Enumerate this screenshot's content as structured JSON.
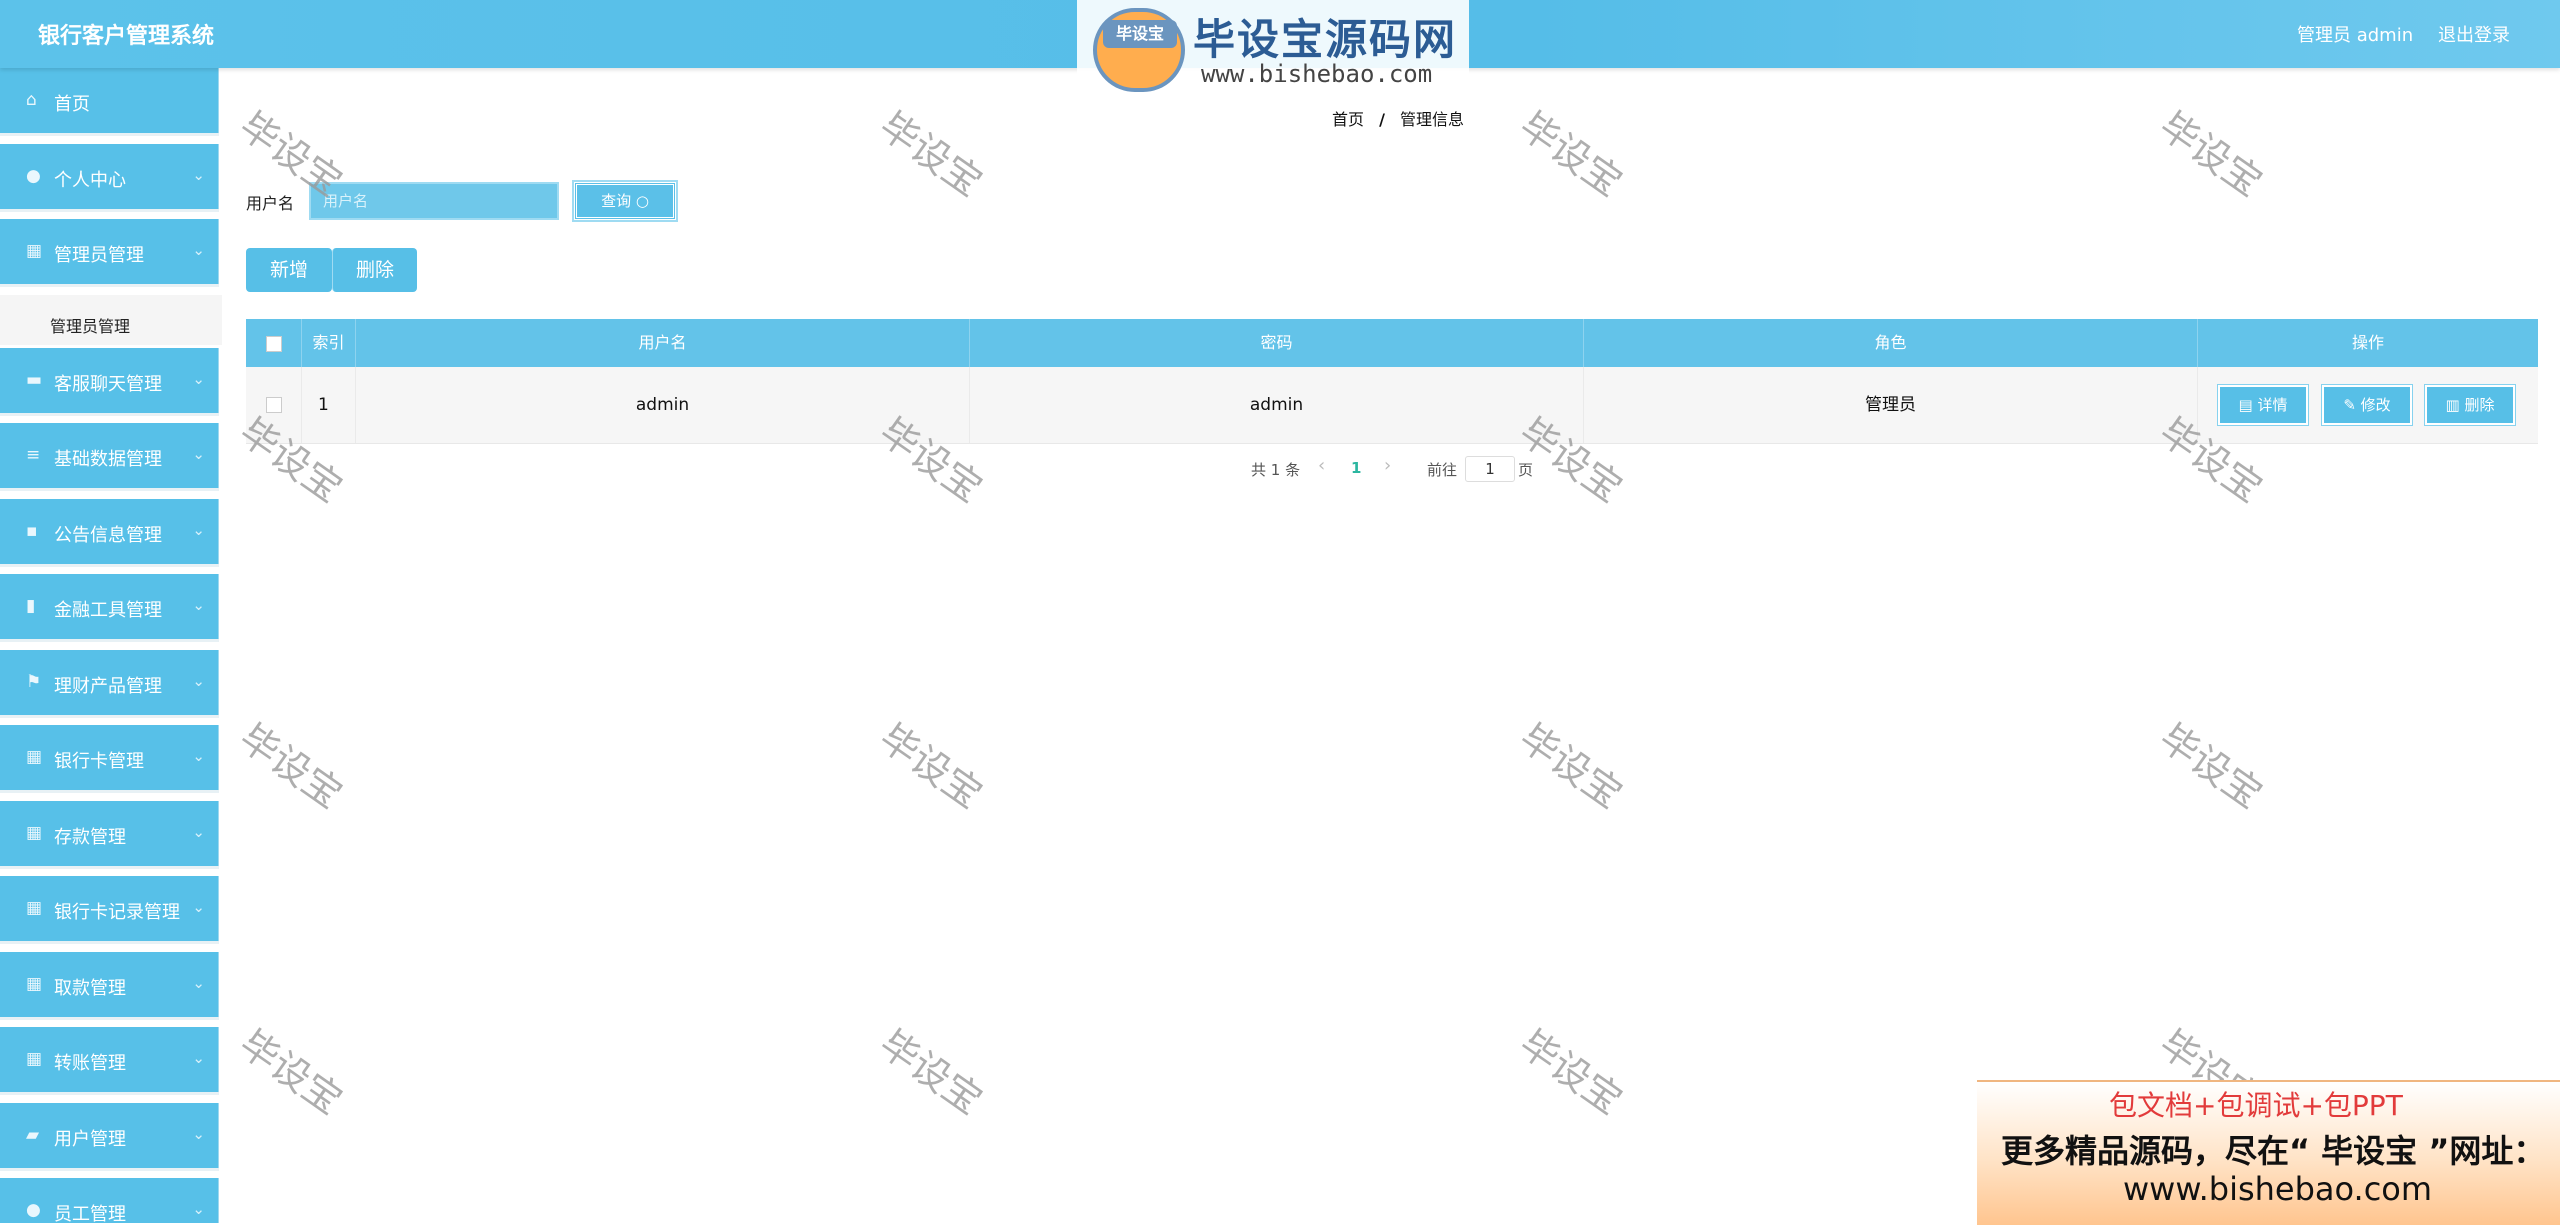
{
  "header": {
    "app_title": "银行客户管理系统",
    "user_label": "管理员 admin",
    "logout_label": "退出登录",
    "logo": {
      "badge_text": "毕设宝",
      "main_text": "毕设宝源码网",
      "url_text": "www.bishebao.com"
    }
  },
  "sidebar": {
    "items": [
      {
        "label": "首页",
        "icon": "home-icon"
      },
      {
        "label": "个人中心",
        "icon": "user-icon"
      },
      {
        "label": "管理员管理",
        "icon": "grid-icon"
      },
      {
        "label": "客服聊天管理",
        "icon": "chat-icon"
      },
      {
        "label": "基础数据管理",
        "icon": "list-icon"
      },
      {
        "label": "公告信息管理",
        "icon": "message-icon"
      },
      {
        "label": "金融工具管理",
        "icon": "bar-chart-icon"
      },
      {
        "label": "理财产品管理",
        "icon": "flag-icon"
      },
      {
        "label": "银行卡管理",
        "icon": "grid-icon"
      },
      {
        "label": "存款管理",
        "icon": "grid-icon"
      },
      {
        "label": "银行卡记录管理",
        "icon": "grid-icon"
      },
      {
        "label": "取款管理",
        "icon": "grid-icon"
      },
      {
        "label": "转账管理",
        "icon": "grid-icon"
      },
      {
        "label": "用户管理",
        "icon": "lock-icon"
      },
      {
        "label": "员工管理",
        "icon": "user-icon"
      }
    ],
    "submenu": {
      "label": "管理员管理"
    },
    "arrow": "⌄"
  },
  "breadcrumb": {
    "home": "首页",
    "separator": "/",
    "current": "管理信息"
  },
  "search": {
    "label": "用户名",
    "placeholder": "用户名",
    "value": "",
    "button_label": "查询 ○"
  },
  "actions": {
    "add_label": "新增",
    "delete_label": "删除"
  },
  "table": {
    "headers": {
      "index": "索引",
      "username": "用户名",
      "password": "密码",
      "role": "角色",
      "ops": "操作"
    },
    "rows": [
      {
        "index": "1",
        "username": "admin",
        "password": "admin",
        "role": "管理员"
      }
    ],
    "ops": {
      "detail": "详情",
      "edit": "修改",
      "delete": "删除"
    }
  },
  "pagination": {
    "total_text": "共 1 条",
    "prev": "‹",
    "current_page": "1",
    "next": "›",
    "goto_label": "前往",
    "goto_value": "1",
    "page_suffix": "页"
  },
  "watermark": "毕设宝",
  "ad": {
    "line1": "包文档+包调试+包PPT",
    "line2": "更多精品源码，尽在“ 毕设宝 ”网址：",
    "line3": "www.bishebao.com"
  },
  "colors": {
    "primary": "#57bfe7",
    "header": "#5cc2ea",
    "ad_red": "#e23b3b"
  }
}
